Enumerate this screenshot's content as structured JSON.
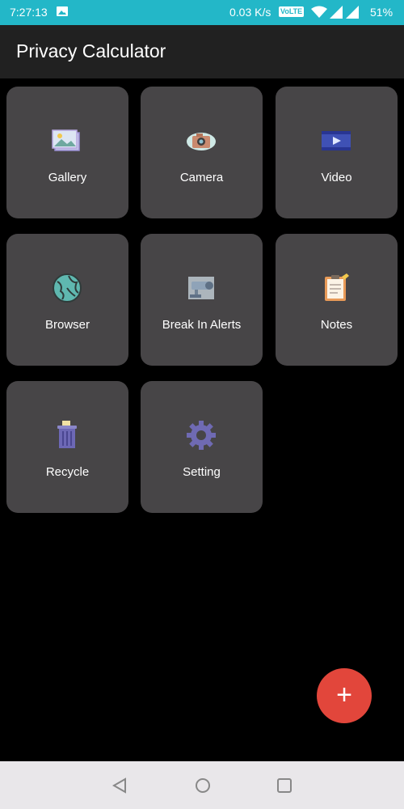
{
  "status_bar": {
    "time": "7:27:13",
    "speed": "0.03 K/s",
    "volte": "VoLTE",
    "battery": "51%",
    "icons": [
      "image-icon",
      "wifi-icon",
      "signal-icon",
      "signal-icon"
    ]
  },
  "app_bar": {
    "title": "Privacy Calculator"
  },
  "tiles": [
    {
      "label": "Gallery",
      "icon": "gallery-icon"
    },
    {
      "label": "Camera",
      "icon": "camera-icon"
    },
    {
      "label": "Video",
      "icon": "video-icon"
    },
    {
      "label": "Browser",
      "icon": "globe-icon"
    },
    {
      "label": "Break In Alerts",
      "icon": "security-camera-icon"
    },
    {
      "label": "Notes",
      "icon": "notepad-icon"
    },
    {
      "label": "Recycle",
      "icon": "trash-icon"
    },
    {
      "label": "Setting",
      "icon": "gear-icon"
    }
  ],
  "fab": {
    "label": "+",
    "color": "#e2463b"
  },
  "nav_bar": {
    "icons": [
      "back-icon",
      "home-icon",
      "recent-apps-icon"
    ]
  },
  "colors": {
    "status_bar": "#23b7c8",
    "app_bar": "#212121",
    "tile": "#474547",
    "background": "#000000"
  }
}
